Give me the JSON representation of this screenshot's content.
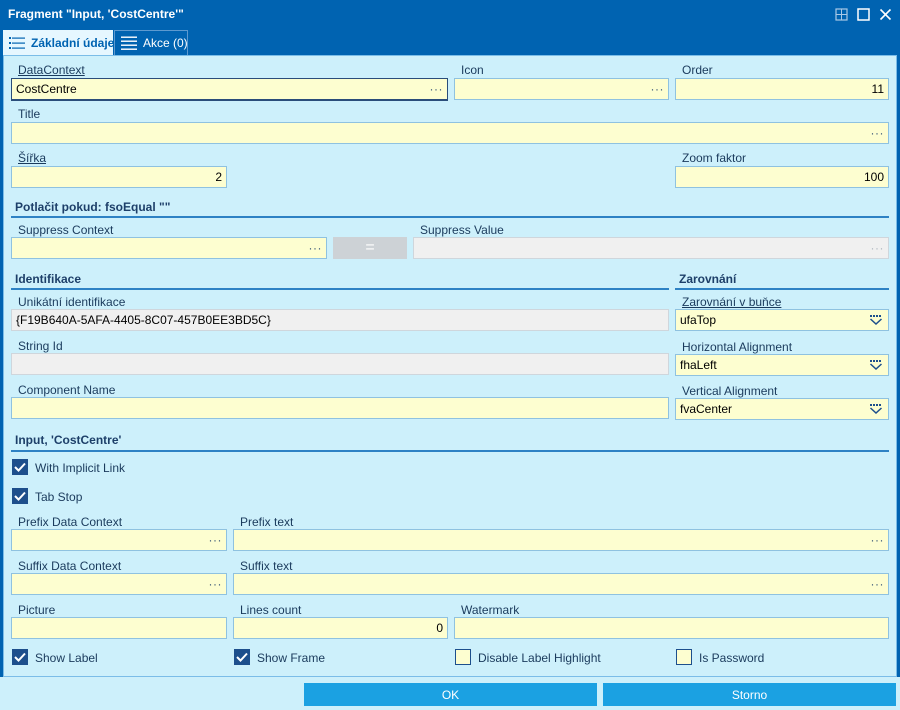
{
  "window": {
    "title": "Fragment \"Input, 'CostCentre'\"",
    "accent": "#0063b1",
    "field_bg": "#fdfed0",
    "panel_bg": "#cdf0fb"
  },
  "tabs": [
    {
      "label": "Základní údaje",
      "icon": "list-icon",
      "active": true
    },
    {
      "label": "Akce (0)",
      "icon": "list-icon",
      "active": false
    }
  ],
  "fields": {
    "datacontext": {
      "label": "DataContext",
      "value": "CostCentre"
    },
    "icon": {
      "label": "Icon",
      "value": ""
    },
    "order": {
      "label": "Order",
      "value": "11"
    },
    "title": {
      "label": "Title",
      "value": ""
    },
    "width": {
      "label": "Šířka",
      "value": "2"
    },
    "zoom": {
      "label": "Zoom faktor",
      "value": "100"
    }
  },
  "suppress": {
    "section": "Potlačit pokud:  fsoEqual \"\"",
    "context_label": "Suppress Context",
    "context_value": "",
    "operator": "=",
    "value_label": "Suppress Value",
    "value": ""
  },
  "identification": {
    "section": "Identifikace",
    "unique_label": "Unikátní identifikace",
    "unique_value": "{F19B640A-5AFA-4405-8C07-457B0EE3BD5C}",
    "string_id_label": "String Id",
    "string_id_value": "",
    "component_label": "Component Name",
    "component_value": ""
  },
  "alignment": {
    "section": "Zarovnání",
    "cell_label": "Zarovnání v buňce",
    "cell_value": "ufaTop",
    "horizontal_label": "Horizontal Alignment",
    "horizontal_value": "fhaLeft",
    "vertical_label": "Vertical Alignment",
    "vertical_value": "fvaCenter"
  },
  "input": {
    "section": "Input, 'CostCentre'",
    "implicit_link": {
      "label": "With Implicit Link",
      "checked": true
    },
    "tab_stop": {
      "label": "Tab Stop",
      "checked": true
    },
    "prefix_dc_label": "Prefix Data Context",
    "prefix_dc_value": "",
    "prefix_text_label": "Prefix text",
    "prefix_text_value": "",
    "suffix_dc_label": "Suffix Data Context",
    "suffix_dc_value": "",
    "suffix_text_label": "Suffix text",
    "suffix_text_value": "",
    "picture_label": "Picture",
    "picture_value": "",
    "lines_label": "Lines count",
    "lines_value": "0",
    "watermark_label": "Watermark",
    "watermark_value": "",
    "show_label": {
      "label": "Show Label",
      "checked": true
    },
    "show_frame": {
      "label": "Show Frame",
      "checked": true
    },
    "disable_highlight": {
      "label": "Disable Label Highlight",
      "checked": false
    },
    "is_password": {
      "label": "Is Password",
      "checked": false
    }
  },
  "buttons": {
    "ok": "OK",
    "cancel": "Storno"
  }
}
